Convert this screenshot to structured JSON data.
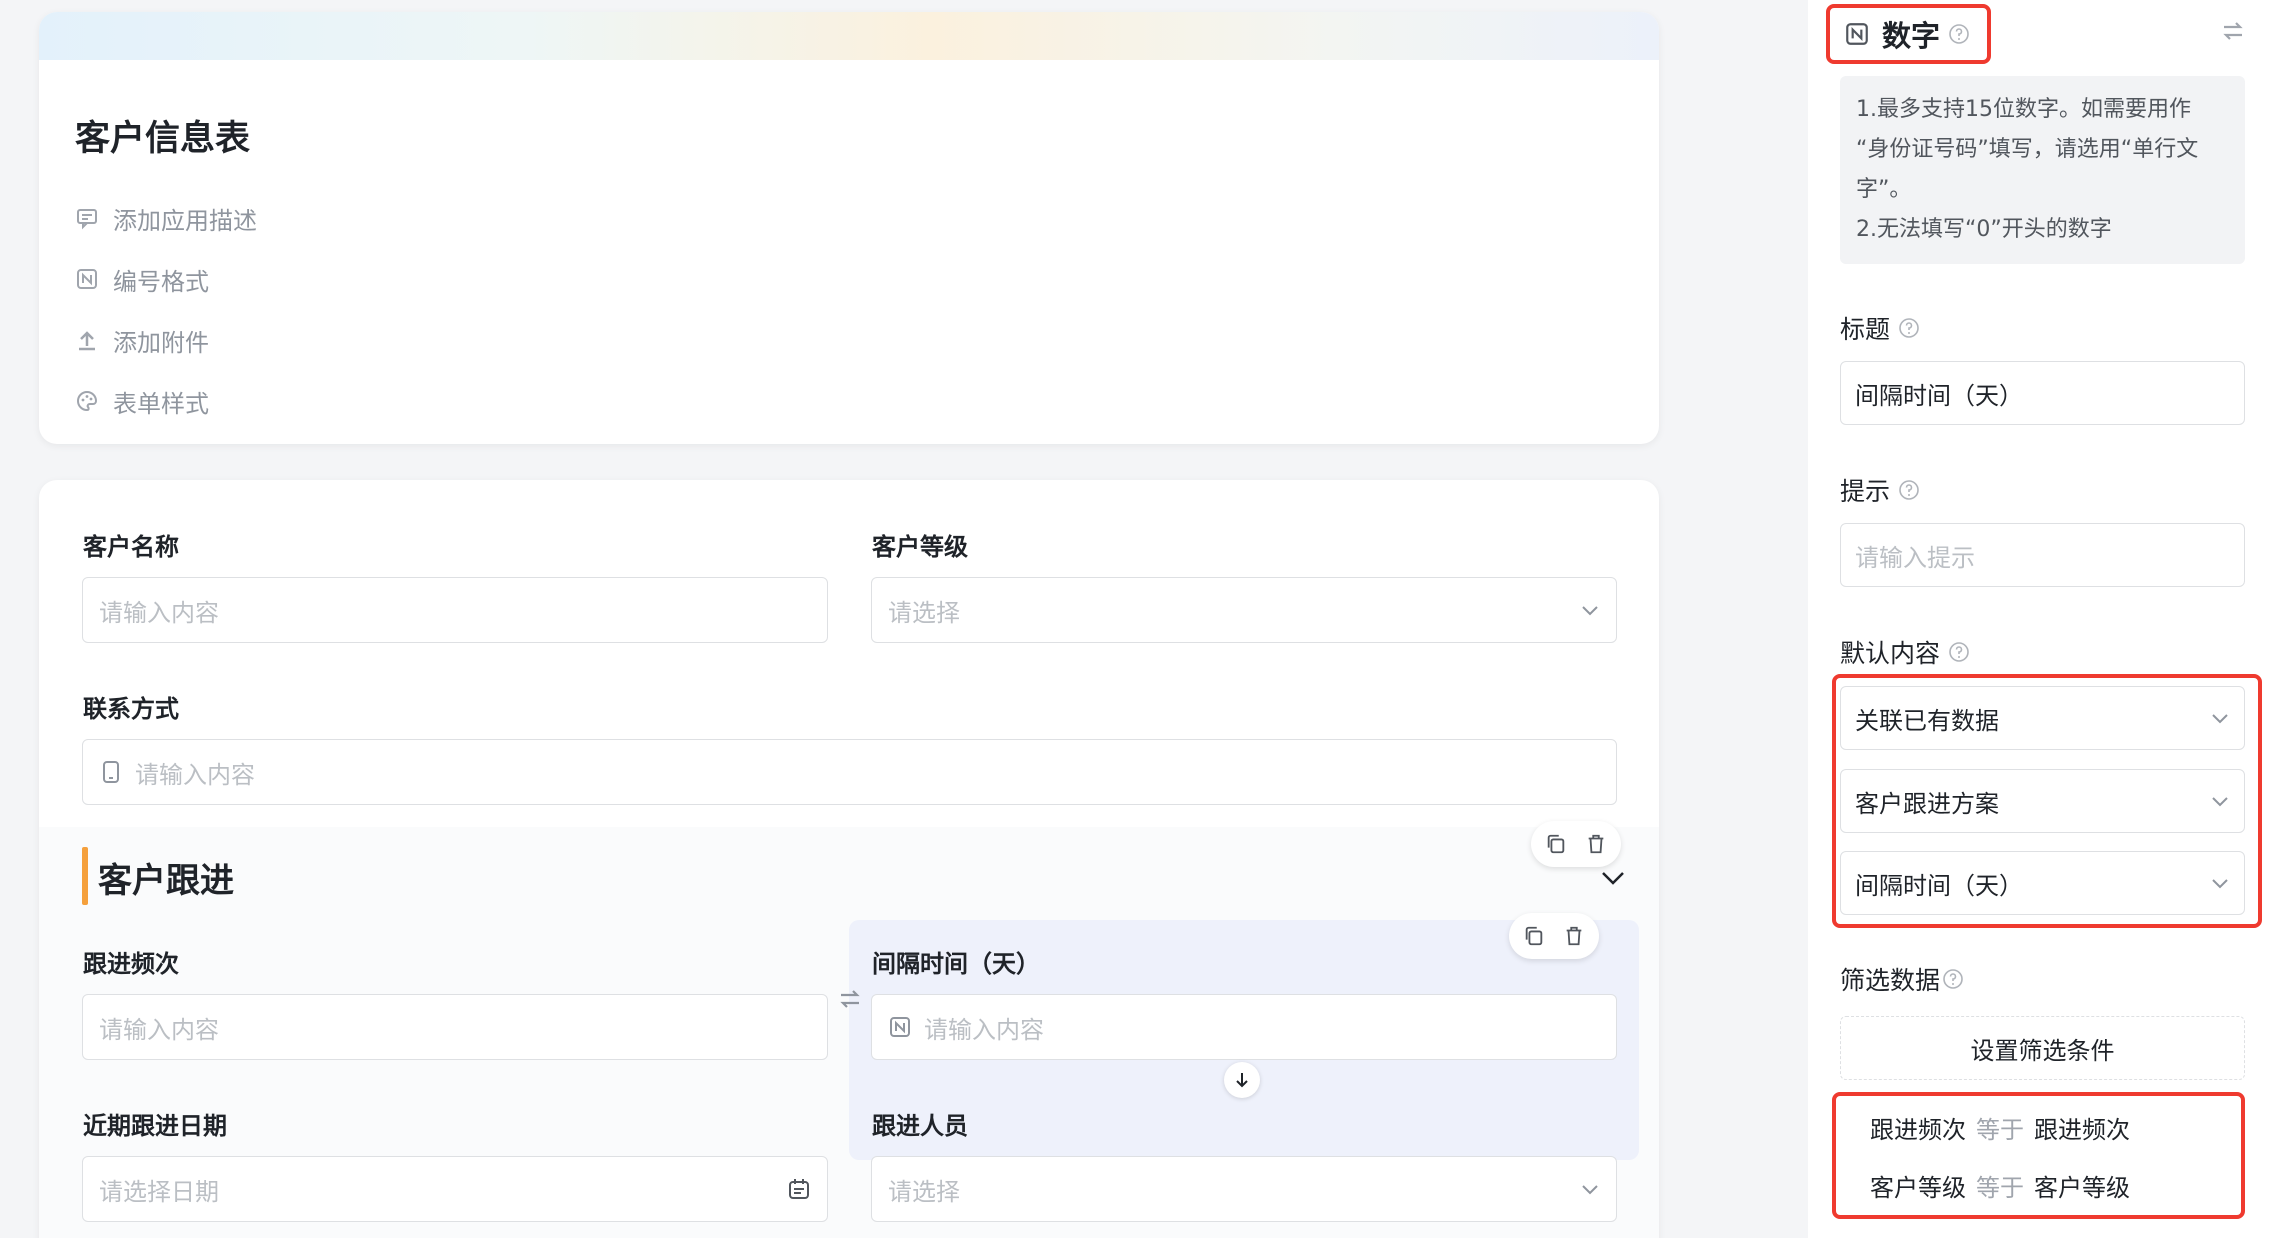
{
  "app": {
    "title": "客户信息表",
    "meta_items": [
      {
        "label": "添加应用描述",
        "icon": "comment-icon"
      },
      {
        "label": "编号格式",
        "icon": "number-format-icon"
      },
      {
        "label": "添加附件",
        "icon": "upload-icon"
      },
      {
        "label": "表单样式",
        "icon": "palette-icon"
      }
    ]
  },
  "form": {
    "fields": {
      "customer_name": {
        "label": "客户名称",
        "placeholder": "请输入内容"
      },
      "customer_level": {
        "label": "客户等级",
        "placeholder": "请选择"
      },
      "contact": {
        "label": "联系方式",
        "placeholder": "请输入内容"
      },
      "follow_freq": {
        "label": "跟进频次",
        "placeholder": "请输入内容"
      },
      "interval": {
        "label": "间隔时间（天）",
        "placeholder": "请输入内容"
      },
      "recent_date": {
        "label": "近期跟进日期",
        "placeholder": "请选择日期"
      },
      "follower": {
        "label": "跟进人员",
        "placeholder": "请选择"
      }
    },
    "section": {
      "title": "客户跟进",
      "accent_color": "#f5a03c"
    }
  },
  "panel": {
    "field_type": "数字",
    "description": [
      "1.最多支持15位数字。如需要用作",
      "“身份证号码”填写，请选用“单行文",
      "字”。",
      "2.无法填写“0”开头的数字"
    ],
    "title_label": "标题",
    "title_value": "间隔时间（天）",
    "hint_label": "提示",
    "hint_placeholder": "请输入提示",
    "default_label": "默认内容",
    "default_selects": [
      "关联已有数据",
      "客户跟进方案",
      "间隔时间（天）"
    ],
    "filter_label": "筛选数据",
    "filter_button": "设置筛选条件",
    "conditions": [
      {
        "field": "跟进频次",
        "op": "等于",
        "value": "跟进频次"
      },
      {
        "field": "客户等级",
        "op": "等于",
        "value": "客户等级"
      }
    ]
  },
  "colors": {
    "highlight_red": "#ef3a2f",
    "accent_orange": "#f5a03c",
    "selected_field_bg": "#eef1fb"
  }
}
